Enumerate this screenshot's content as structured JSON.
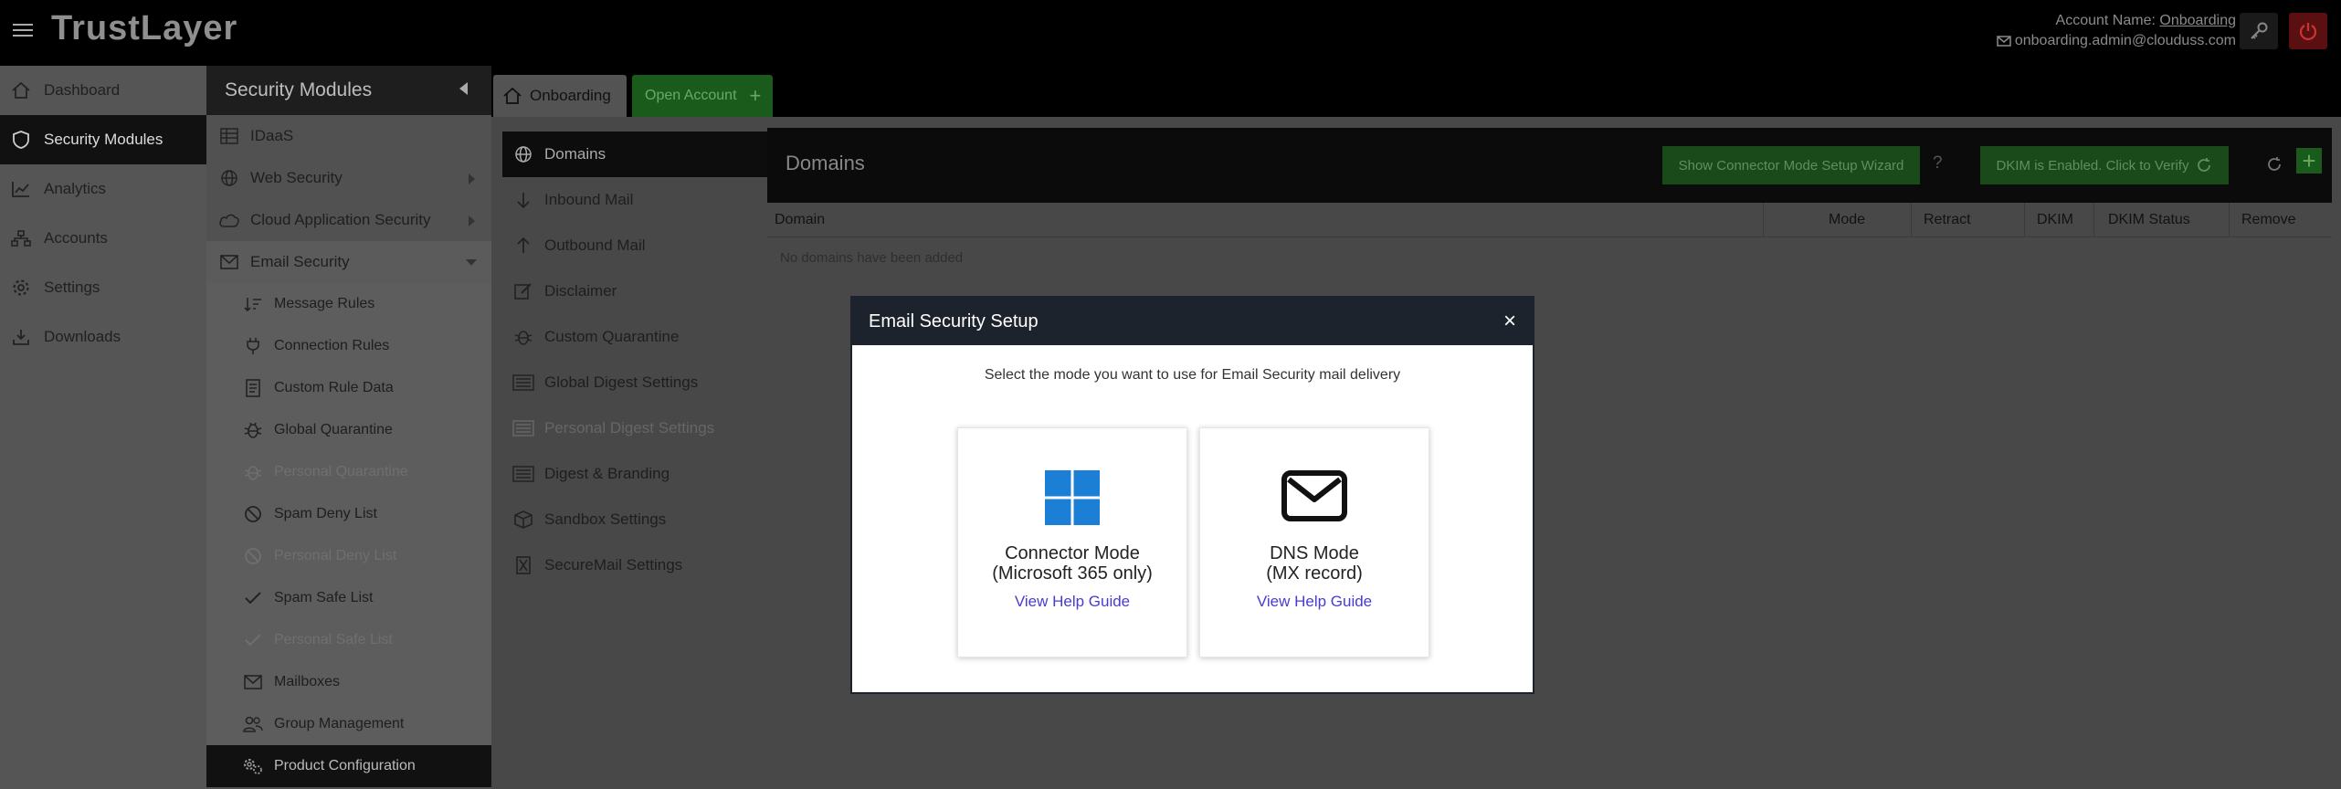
{
  "app": {
    "logo_text": "TrustLayer",
    "account_label": "Account Name:",
    "account_name": "Onboarding",
    "account_email": "onboarding.admin@clouduss.com"
  },
  "leftnav": {
    "items": [
      {
        "label": "Dashboard",
        "icon": "home-icon"
      },
      {
        "label": "Security Modules",
        "icon": "shield-icon"
      },
      {
        "label": "Analytics",
        "icon": "chart-icon"
      },
      {
        "label": "Accounts",
        "icon": "accounts-icon"
      },
      {
        "label": "Settings",
        "icon": "gear-icon"
      },
      {
        "label": "Downloads",
        "icon": "download-icon"
      }
    ]
  },
  "security_modules": {
    "title": "Security Modules",
    "items": [
      {
        "label": "IDaaS"
      },
      {
        "label": "Web Security"
      },
      {
        "label": "Cloud Application Security"
      },
      {
        "label": "Email Security"
      }
    ],
    "email_sub": [
      {
        "label": "Message Rules"
      },
      {
        "label": "Connection Rules"
      },
      {
        "label": "Custom Rule Data"
      },
      {
        "label": "Global Quarantine"
      },
      {
        "label": "Personal Quarantine"
      },
      {
        "label": "Spam Deny List"
      },
      {
        "label": "Personal Deny List"
      },
      {
        "label": "Spam Safe List"
      },
      {
        "label": "Personal Safe List"
      },
      {
        "label": "Mailboxes"
      },
      {
        "label": "Group Management"
      },
      {
        "label": "Product Configuration"
      }
    ]
  },
  "tabs": {
    "onboarding": "Onboarding",
    "open_account": "Open Account"
  },
  "submenu": {
    "items": [
      {
        "label": "Domains"
      },
      {
        "label": "Inbound Mail"
      },
      {
        "label": "Outbound Mail"
      },
      {
        "label": "Disclaimer"
      },
      {
        "label": "Custom Quarantine"
      },
      {
        "label": "Global Digest Settings"
      },
      {
        "label": "Personal Digest Settings"
      },
      {
        "label": "Digest & Branding"
      },
      {
        "label": "Sandbox Settings"
      },
      {
        "label": "SecureMail Settings"
      }
    ]
  },
  "domains": {
    "title": "Domains",
    "wizard_button": "Show Connector Mode Setup Wizard",
    "help": "?",
    "dkim_button": "DKIM is Enabled. Click to Verify",
    "columns": [
      "Domain",
      "Mode",
      "Retract",
      "DKIM",
      "DKIM Status",
      "Remove"
    ],
    "empty": "No domains have been added"
  },
  "modal": {
    "title": "Email Security Setup",
    "close": "×",
    "subtitle": "Select the mode you want to use for Email Security mail delivery",
    "cards": [
      {
        "title_line1": "Connector Mode",
        "title_line2": "(Microsoft 365 only)",
        "link": "View Help Guide",
        "icon": "windows-icon"
      },
      {
        "title_line1": "DNS Mode",
        "title_line2": "(MX record)",
        "link": "View Help Guide",
        "icon": "envelope-icon"
      }
    ]
  },
  "colors": {
    "modal_header": "#1d232c",
    "link": "#4a3bd1",
    "windows_blue": "#1b7fd6",
    "green_button": "#1a4a1a"
  }
}
